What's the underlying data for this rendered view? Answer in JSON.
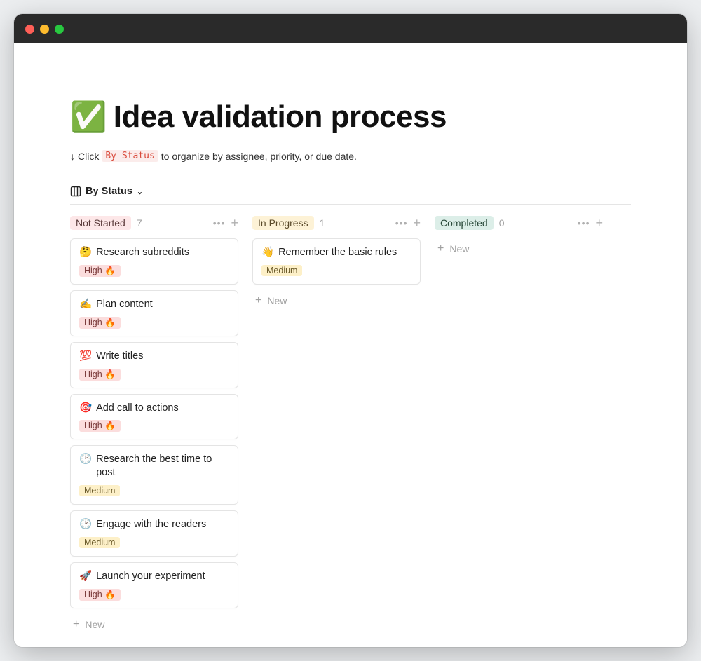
{
  "page": {
    "emoji": "✅",
    "title": "Idea validation process"
  },
  "subtitle": {
    "arrow": "↓",
    "pre": "Click",
    "code": "By Status",
    "post": "to organize by assignee, priority, or due date."
  },
  "view": {
    "label": "By Status"
  },
  "new_label": "New",
  "priority_labels": {
    "high": "High 🔥",
    "medium": "Medium"
  },
  "columns": [
    {
      "key": "not_started",
      "label": "Not Started",
      "label_class": "label-notstarted",
      "count": "7",
      "cards": [
        {
          "emoji": "🤔",
          "title": "Research subreddits",
          "priority": "high"
        },
        {
          "emoji": "✍️",
          "title": "Plan content",
          "priority": "high"
        },
        {
          "emoji": "💯",
          "title": "Write titles",
          "priority": "high"
        },
        {
          "emoji": "🎯",
          "title": "Add call to actions",
          "priority": "high"
        },
        {
          "emoji": "🕑",
          "title": "Research the best time to post",
          "priority": "medium"
        },
        {
          "emoji": "🕑",
          "title": "Engage with the readers",
          "priority": "medium"
        },
        {
          "emoji": "🚀",
          "title": "Launch your experiment",
          "priority": "high"
        }
      ]
    },
    {
      "key": "in_progress",
      "label": "In Progress",
      "label_class": "label-inprogress",
      "count": "1",
      "cards": [
        {
          "emoji": "👋",
          "title": "Remember the basic rules",
          "priority": "medium"
        }
      ]
    },
    {
      "key": "completed",
      "label": "Completed",
      "label_class": "label-completed",
      "count": "0",
      "cards": []
    }
  ]
}
